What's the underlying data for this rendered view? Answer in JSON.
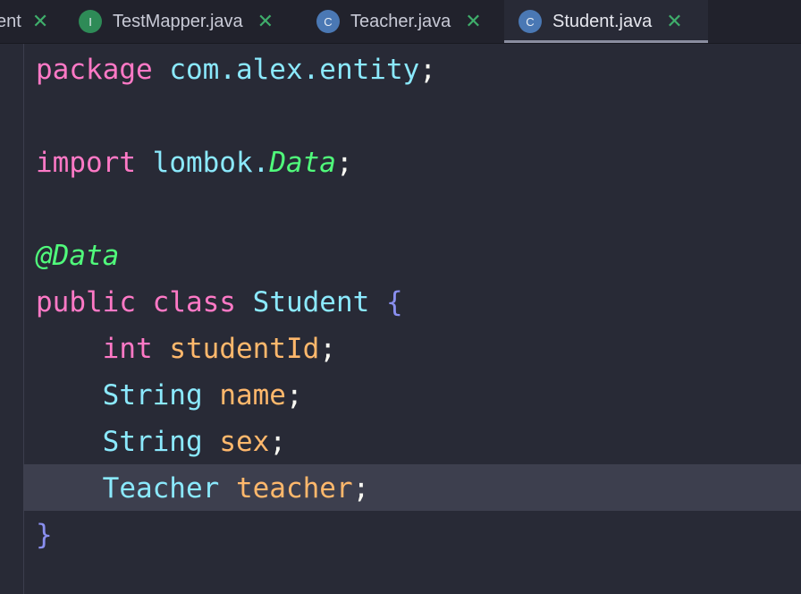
{
  "tabs": [
    {
      "label": "ent",
      "icon": "",
      "close": "✕",
      "active": false
    },
    {
      "label": "TestMapper.java",
      "icon": "I",
      "close": "✕",
      "active": false
    },
    {
      "label": "Teacher.java",
      "icon": "C",
      "close": "✕",
      "active": false
    },
    {
      "label": "Student.java",
      "icon": "C",
      "close": "✕",
      "active": true
    }
  ],
  "code": {
    "l1": {
      "kw": "package",
      "pkg": "com.alex.entity",
      "semi": ";"
    },
    "l3": {
      "kw": "import",
      "pkg": "lombok.",
      "cls": "Data",
      "semi": ";"
    },
    "l5": {
      "ann": "@Data"
    },
    "l6": {
      "kw1": "public",
      "kw2": "class",
      "name": "Student",
      "brace": "{"
    },
    "l7": {
      "type": "int",
      "field": "studentId",
      "semi": ";"
    },
    "l8": {
      "type": "String",
      "field": "name",
      "semi": ";"
    },
    "l9": {
      "type": "String",
      "field": "sex",
      "semi": ";"
    },
    "l10": {
      "type": "Teacher",
      "field": "teacher",
      "semi": ";"
    },
    "l11": {
      "brace": "}"
    }
  }
}
